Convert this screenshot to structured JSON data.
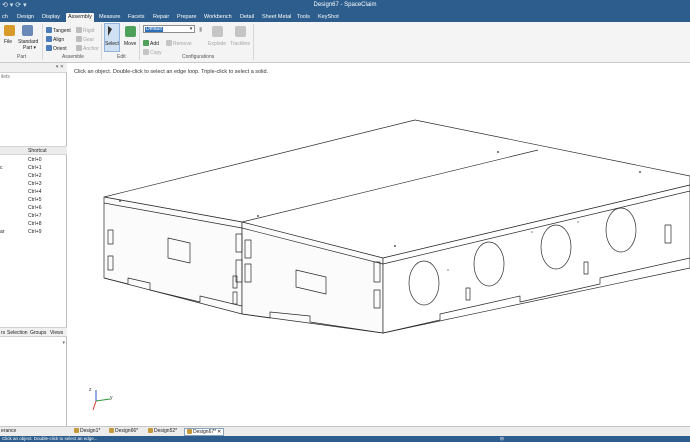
{
  "window": {
    "title": "Design67 - SpaceClaim",
    "quick_access": "⟲ ▾  ⟳ ▾"
  },
  "ribbon_tabs": [
    "ch",
    "Design",
    "Display",
    "Assembly",
    "Measure",
    "Facets",
    "Repair",
    "Prepare",
    "Workbench",
    "Detail",
    "Sheet Metal",
    "Tools",
    "KeyShot"
  ],
  "active_tab": "Assembly",
  "ribbon": {
    "part": {
      "file": "File",
      "standard_part": "Standard",
      "standard_part_2": "Part ▾",
      "group": "Part"
    },
    "assemble": {
      "tangent": "Tangent",
      "rigid": "Rigid",
      "align": "Align",
      "gear": "Gear",
      "orient": "Orient",
      "anchor": "Anchor",
      "group": "Assemble"
    },
    "edit": {
      "select": "Select",
      "move": "Move",
      "group": "Edit"
    },
    "configurations": {
      "combo_value": "Default",
      "add": "Add",
      "remove": "Remove",
      "copy": "Copy",
      "explode": "Explode",
      "trackline": "Trackline",
      "group": "Configurations"
    }
  },
  "left_panel": {
    "sub_title": "ilets",
    "shortcut_header": "Shortcut",
    "shortcuts": [
      {
        "name": "",
        "key": "Ctrl+0"
      },
      {
        "name": "c",
        "key": "Ctrl+1"
      },
      {
        "name": "",
        "key": "Ctrl+2"
      },
      {
        "name": "",
        "key": "Ctrl+3"
      },
      {
        "name": "",
        "key": "Ctrl+4"
      },
      {
        "name": "",
        "key": "Ctrl+5"
      },
      {
        "name": "",
        "key": "Ctrl+6"
      },
      {
        "name": "",
        "key": "Ctrl+7"
      },
      {
        "name": "",
        "key": "Ctrl+8"
      },
      {
        "name": "ar",
        "key": "Ctrl+9"
      }
    ],
    "tabs": [
      "rs",
      "Selection",
      "Groups",
      "Views"
    ]
  },
  "hint": "Click an object. Double-click to select an edge loop. Triple-click to select a solid.",
  "axis_labels": {
    "y": "y",
    "z": "z"
  },
  "bottom_left": "erance",
  "doc_tabs": [
    "Design1*",
    "Design66*",
    "Design52*",
    "Design67*"
  ],
  "active_doc": "Design67*",
  "status": {
    "left": "Click an object. Double-click to select an edge...",
    "right": "⊟"
  }
}
